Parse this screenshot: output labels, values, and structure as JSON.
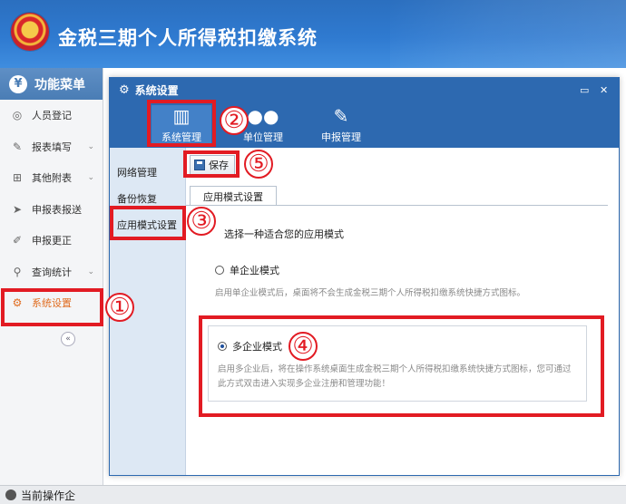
{
  "app": {
    "title": "金税三期个人所得税扣缴系统"
  },
  "menu": {
    "header": "功能菜单",
    "items": [
      {
        "label": "人员登记",
        "icon": "person-icon",
        "glyph": "◎",
        "chevron": false,
        "active": false
      },
      {
        "label": "报表填写",
        "icon": "edit-icon",
        "glyph": "✎",
        "chevron": true,
        "active": false
      },
      {
        "label": "其他附表",
        "icon": "grid-icon",
        "glyph": "⊞",
        "chevron": true,
        "active": false
      },
      {
        "label": "申报表报送",
        "icon": "send-icon",
        "glyph": "➤",
        "chevron": false,
        "active": false
      },
      {
        "label": "申报更正",
        "icon": "pen-icon",
        "glyph": "✐",
        "chevron": false,
        "active": false
      },
      {
        "label": "查询统计",
        "icon": "search-icon",
        "glyph": "⚲",
        "chevron": true,
        "active": false
      },
      {
        "label": "系统设置",
        "icon": "gear-icon",
        "glyph": "⚙",
        "chevron": false,
        "active": true
      }
    ],
    "collapse": "«"
  },
  "status": {
    "text": "当前操作企"
  },
  "dialog": {
    "title": "系统设置",
    "toolbar": [
      {
        "label": "系统管理",
        "icon": "lock-icon",
        "glyph": "🔒"
      },
      {
        "label": "单位管理",
        "icon": "users-icon",
        "glyph": "👥"
      },
      {
        "label": "申报管理",
        "icon": "report-icon",
        "glyph": "✎"
      }
    ],
    "nav": [
      "网络管理",
      "备份恢复",
      "应用模式设置"
    ],
    "save_label": "保存",
    "tab_label": "应用模式设置",
    "prompt": "选择一种适合您的应用模式",
    "single": {
      "label": "单企业模式",
      "desc": "启用单企业模式后，桌面将不会生成金税三期个人所得税扣缴系统快捷方式图标。"
    },
    "multi": {
      "label": "多企业模式",
      "desc": "启用多企业后，将在操作系统桌面生成金税三期个人所得税扣缴系统快捷方式图标，您可通过此方式双击进入实现多企业注册和管理功能！"
    }
  },
  "annotations": [
    "①",
    "②",
    "③",
    "④",
    "⑤"
  ],
  "colors": {
    "brand_blue": "#2d69b0",
    "annotation_red": "#e21b23",
    "active_menu": "#e06c1f"
  }
}
